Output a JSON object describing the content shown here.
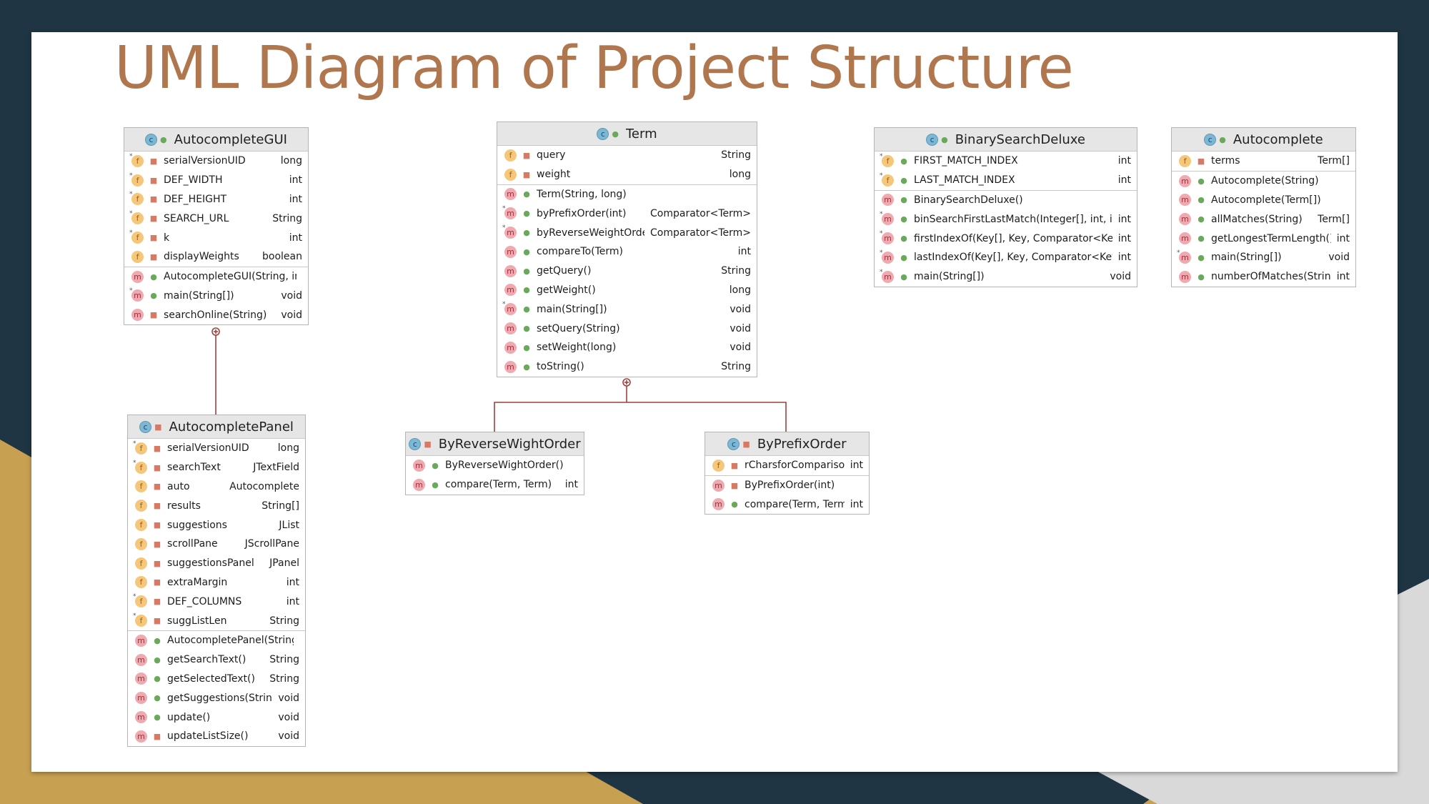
{
  "title": "UML Diagram of Project Structure",
  "colors": {
    "title": "#b0774f",
    "background_dark": "#1f3543",
    "background_gold": "#c8a052",
    "connector": "#a0403a"
  },
  "classes": {
    "autocompleteGUI": {
      "name": "AutocompleteGUI",
      "fields": [
        {
          "name": "serialVersionUID",
          "type": "long"
        },
        {
          "name": "DEF_WIDTH",
          "type": "int"
        },
        {
          "name": "DEF_HEIGHT",
          "type": "int"
        },
        {
          "name": "SEARCH_URL",
          "type": "String"
        },
        {
          "name": "k",
          "type": "int"
        },
        {
          "name": "displayWeights",
          "type": "boolean"
        }
      ],
      "methods": [
        {
          "name": "AutocompleteGUI(String, int)",
          "type": ""
        },
        {
          "name": "main(String[])",
          "type": "void"
        },
        {
          "name": "searchOnline(String)",
          "type": "void"
        }
      ]
    },
    "term": {
      "name": "Term",
      "fields": [
        {
          "name": "query",
          "type": "String"
        },
        {
          "name": "weight",
          "type": "long"
        }
      ],
      "methods": [
        {
          "name": "Term(String, long)",
          "type": ""
        },
        {
          "name": "byPrefixOrder(int)",
          "type": "Comparator<Term>"
        },
        {
          "name": "byReverseWeightOrder()",
          "type": "Comparator<Term>"
        },
        {
          "name": "compareTo(Term)",
          "type": "int"
        },
        {
          "name": "getQuery()",
          "type": "String"
        },
        {
          "name": "getWeight()",
          "type": "long"
        },
        {
          "name": "main(String[])",
          "type": "void"
        },
        {
          "name": "setQuery(String)",
          "type": "void"
        },
        {
          "name": "setWeight(long)",
          "type": "void"
        },
        {
          "name": "toString()",
          "type": "String"
        }
      ]
    },
    "binarySearchDeluxe": {
      "name": "BinarySearchDeluxe",
      "fields": [
        {
          "name": "FIRST_MATCH_INDEX",
          "type": "int"
        },
        {
          "name": "LAST_MATCH_INDEX",
          "type": "int"
        }
      ],
      "methods": [
        {
          "name": "BinarySearchDeluxe()",
          "type": ""
        },
        {
          "name": "binSearchFirstLastMatch(Integer[], int, int)",
          "type": "int"
        },
        {
          "name": "firstIndexOf(Key[], Key, Comparator<Key>)",
          "type": "int"
        },
        {
          "name": "lastIndexOf(Key[], Key, Comparator<Key>)",
          "type": "int"
        },
        {
          "name": "main(String[])",
          "type": "void"
        }
      ]
    },
    "autocomplete": {
      "name": "Autocomplete",
      "fields": [
        {
          "name": "terms",
          "type": "Term[]"
        }
      ],
      "methods": [
        {
          "name": "Autocomplete(String)",
          "type": ""
        },
        {
          "name": "Autocomplete(Term[])",
          "type": ""
        },
        {
          "name": "allMatches(String)",
          "type": "Term[]"
        },
        {
          "name": "getLongestTermLength()",
          "type": "int"
        },
        {
          "name": "main(String[])",
          "type": "void"
        },
        {
          "name": "numberOfMatches(String)",
          "type": "int"
        }
      ]
    },
    "autocompletePanel": {
      "name": "AutocompletePanel",
      "fields": [
        {
          "name": "serialVersionUID",
          "type": "long"
        },
        {
          "name": "searchText",
          "type": "JTextField"
        },
        {
          "name": "auto",
          "type": "Autocomplete"
        },
        {
          "name": "results",
          "type": "String[]"
        },
        {
          "name": "suggestions",
          "type": "JList"
        },
        {
          "name": "scrollPane",
          "type": "JScrollPane"
        },
        {
          "name": "suggestionsPanel",
          "type": "JPanel"
        },
        {
          "name": "extraMargin",
          "type": "int"
        },
        {
          "name": "DEF_COLUMNS",
          "type": "int"
        },
        {
          "name": "suggListLen",
          "type": "String"
        }
      ],
      "methods": [
        {
          "name": "AutocompletePanel(String)",
          "type": ""
        },
        {
          "name": "getSearchText()",
          "type": "String"
        },
        {
          "name": "getSelectedText()",
          "type": "String"
        },
        {
          "name": "getSuggestions(String)",
          "type": "void"
        },
        {
          "name": "update()",
          "type": "void"
        },
        {
          "name": "updateListSize()",
          "type": "void"
        }
      ]
    },
    "byReverseWightOrder": {
      "name": "ByReverseWightOrder",
      "fields": [],
      "methods": [
        {
          "name": "ByReverseWightOrder()",
          "type": ""
        },
        {
          "name": "compare(Term, Term)",
          "type": "int"
        }
      ]
    },
    "byPrefixOrder": {
      "name": "ByPrefixOrder",
      "fields": [
        {
          "name": "rCharsforComparison",
          "type": "int"
        }
      ],
      "methods": [
        {
          "name": "ByPrefixOrder(int)",
          "type": ""
        },
        {
          "name": "compare(Term, Term)",
          "type": "int"
        }
      ]
    }
  }
}
